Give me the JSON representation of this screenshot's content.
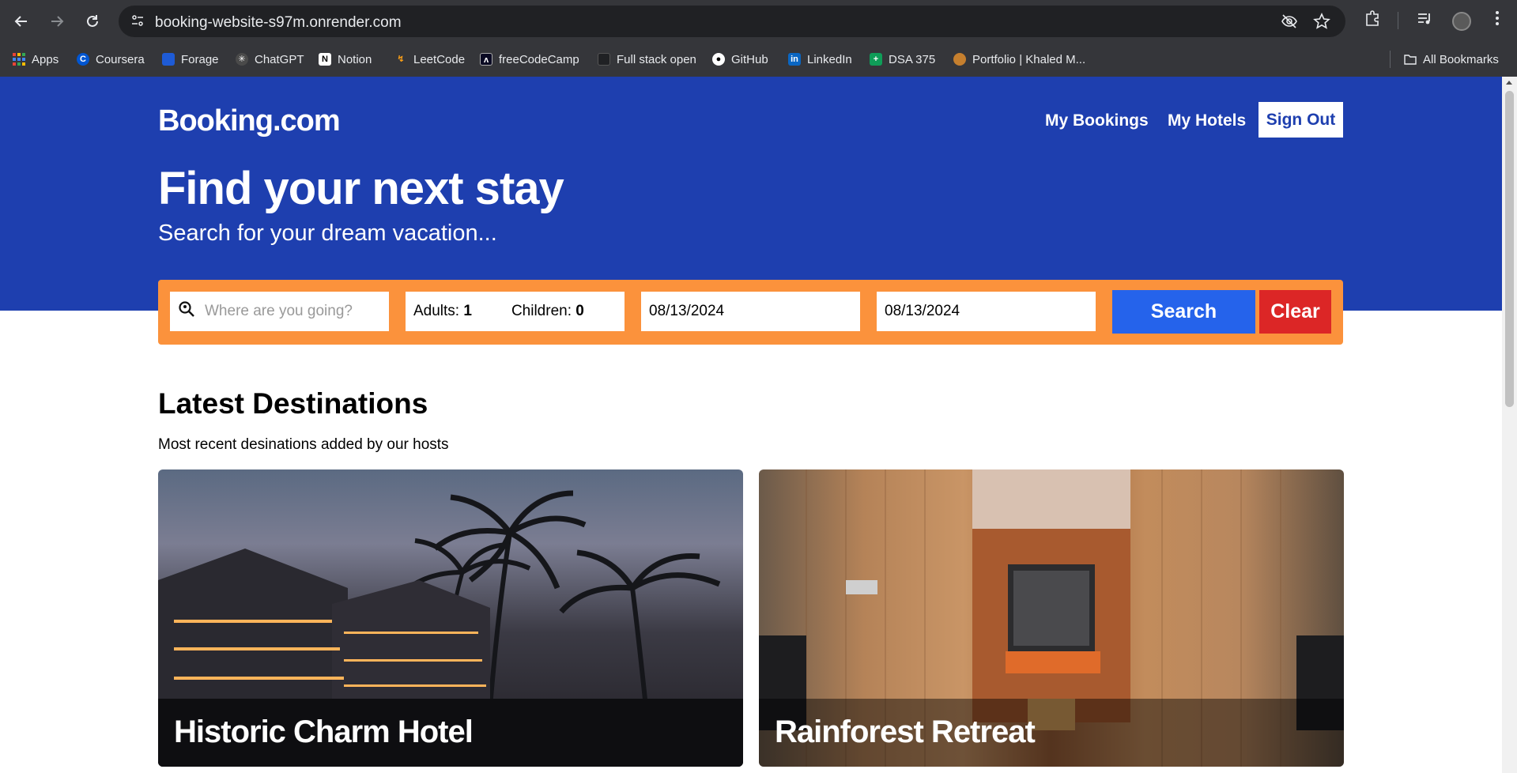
{
  "browser": {
    "url": "booking-website-s97m.onrender.com",
    "icons": [
      "back-icon",
      "forward-icon",
      "reload-icon",
      "site-info-icon",
      "eye-off-icon",
      "star-icon",
      "extensions-icon",
      "media-icon",
      "profile-avatar",
      "more-icon"
    ],
    "bookmarks": [
      {
        "label": "Apps",
        "color": "#4285f4"
      },
      {
        "label": "Coursera",
        "color": "#0056d2"
      },
      {
        "label": "Forage",
        "color": "#1e5bd6"
      },
      {
        "label": "ChatGPT",
        "color": "#6b6b6b"
      },
      {
        "label": "Notion",
        "color": "#ffffff"
      },
      {
        "label": "LeetCode",
        "color": "#ffa116"
      },
      {
        "label": "freeCodeCamp",
        "color": "#0a0a23"
      },
      {
        "label": "Full stack open",
        "color": "#202124"
      },
      {
        "label": "GitHub",
        "color": "#ffffff"
      },
      {
        "label": "LinkedIn",
        "color": "#0a66c2"
      },
      {
        "label": "DSA 375",
        "color": "#0f9d58"
      },
      {
        "label": "Portfolio | Khaled M...",
        "color": "#c57f2e"
      }
    ],
    "all_bookmarks": "All Bookmarks"
  },
  "header": {
    "logo": "Booking.com",
    "nav": {
      "my_bookings": "My Bookings",
      "my_hotels": "My Hotels",
      "sign_out": "Sign Out"
    },
    "title": "Find your next stay",
    "subtitle": "Search for your dream vacation..."
  },
  "search": {
    "destination_placeholder": "Where are you going?",
    "adults_label": "Adults:",
    "adults_value": "1",
    "children_label": "Children:",
    "children_value": "0",
    "check_in": "08/13/2024",
    "check_out": "08/13/2024",
    "search_button": "Search",
    "clear_button": "Clear"
  },
  "latest": {
    "title": "Latest Destinations",
    "subtitle": "Most recent desinations added by our hosts",
    "cards": [
      {
        "name": "Historic Charm Hotel"
      },
      {
        "name": "Rainforest Retreat"
      }
    ]
  },
  "colors": {
    "brand_blue": "#1e3faf",
    "search_orange": "#fb923c",
    "search_button": "#2563eb",
    "clear_button": "#dc2626"
  }
}
